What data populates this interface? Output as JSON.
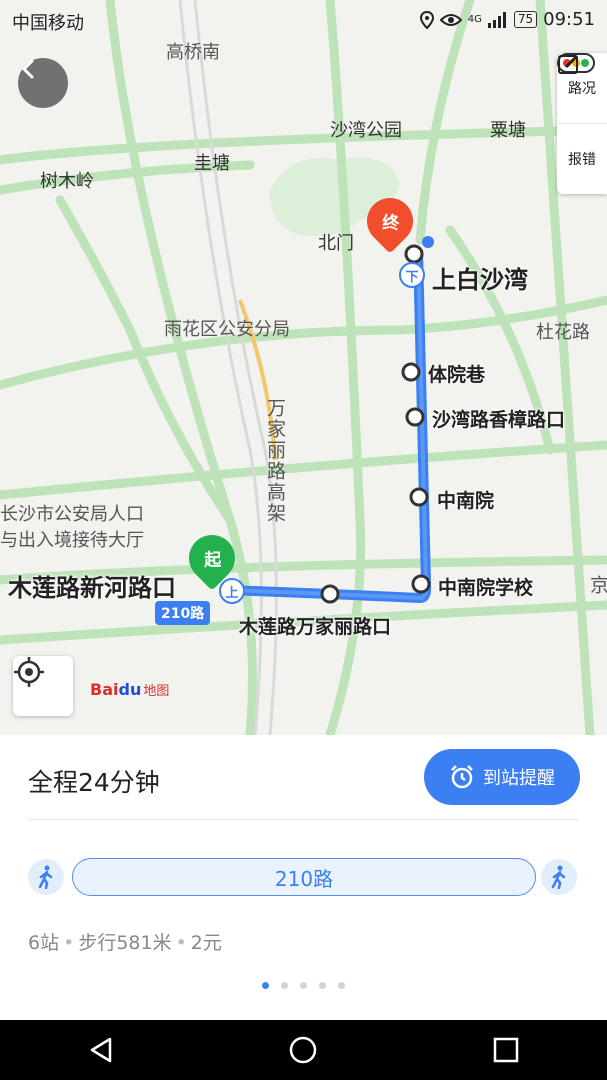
{
  "status_bar": {
    "carrier": "中国移动",
    "network": "4G",
    "battery": "75",
    "time": "09:51"
  },
  "map": {
    "place_labels": {
      "gaoqiaonan": "高桥南",
      "shawan_park": "沙湾公园",
      "litang": "粟塘",
      "shumuling": "树木岭",
      "guitang": "圭塘",
      "beimen": "北门",
      "duhualu": "杜花路",
      "yuhua_police": "雨花区公安分局",
      "wanjiali_elevated": "万家丽路高架",
      "changsha_police_1": "长沙市公安局人口",
      "changsha_police_2": "与出入境接待大厅",
      "jing": "京"
    },
    "stops": {
      "start": "木莲路新河路口",
      "end": "上白沙湾",
      "s1": "体院巷",
      "s2": "沙湾路香樟路口",
      "s3": "中南院",
      "s4": "中南院学校",
      "s5": "木莲路万家丽路口"
    },
    "route_badge": "210路",
    "start_marker": "起",
    "end_marker": "终",
    "board_badge": "上",
    "alight_badge": "下",
    "controls": {
      "traffic_label": "路况",
      "report_label": "报错"
    },
    "logo": {
      "bai": "Bai",
      "du": "du",
      "ditu": "地图"
    }
  },
  "card": {
    "duration": "全程24分钟",
    "remind_button": "到站提醒",
    "route_pill": "210路",
    "summary": {
      "stops": "6站",
      "walk": "步行581米",
      "fare": "2元"
    },
    "pager_count": 5,
    "pager_active": 0
  },
  "colors": {
    "accent": "#3b7ff2",
    "start": "#23b14d",
    "end": "#f24d2c",
    "road": "#a9dba3"
  }
}
